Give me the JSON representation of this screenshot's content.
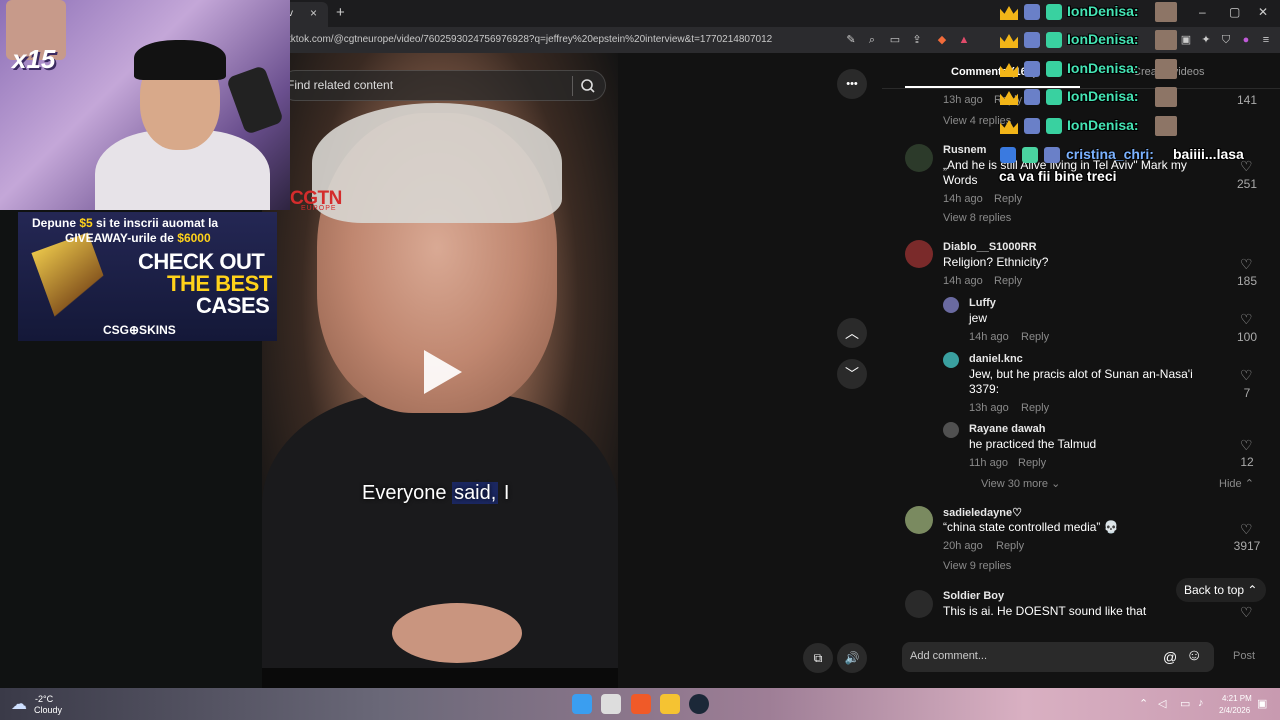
{
  "browser": {
    "tab_label": "v",
    "tab_close": "×",
    "new_tab": "+",
    "url": "tktok.com/@cgtneurope/video/7602593024756976928?q=jeffrey%20epstein%20interview&t=1770214807012",
    "window_controls": [
      "–",
      "▢",
      "✕"
    ]
  },
  "video": {
    "search_placeholder": "Find related content",
    "channel_logo": "CGTN",
    "channel_logo_sub": "EUROPE",
    "caption_plain": "Everyone ",
    "caption_highlight": "said,",
    "caption_tail": " I",
    "more_icon": "•••",
    "up_icon": "︿",
    "down_icon": "﹀",
    "volume_icon": "🔊",
    "pip_icon": "⧉"
  },
  "comments_panel": {
    "tab_comments": "Comments (163)",
    "tab_creator": "Creator videos",
    "first_partial": {
      "meta": "13h ago",
      "reply": "Reply",
      "likes": "141",
      "view_replies": "View 4 replies"
    },
    "comments": [
      {
        "user": "Rusnem",
        "text": "„And he is still Alive living in Tel Aviv\" Mark my Words",
        "meta": "14h ago",
        "reply": "Reply",
        "likes": "251",
        "view_replies": "View 8 replies"
      },
      {
        "user": "Diablo__S1000RR",
        "text": "Religion? Ethnicity?",
        "meta": "14h ago",
        "reply": "Reply",
        "likes": "185"
      },
      {
        "user": "sadieledayne♡",
        "text": "“china state controlled media” 💀",
        "meta": "20h ago",
        "reply": "Reply",
        "likes": "3917",
        "view_replies": "View 9 replies"
      },
      {
        "user": "Soldier Boy",
        "text": "This is ai. He DOESNT sound like that"
      }
    ],
    "replies": [
      {
        "user": "Luffy",
        "text": "jew",
        "meta": "14h ago",
        "reply": "Reply",
        "likes": "100"
      },
      {
        "user": "daniel.knc",
        "text": "Jew, but he pracis alot of Sunan an-Nasa'i 3379:",
        "meta": "13h ago",
        "reply": "Reply",
        "likes": "7"
      },
      {
        "user": "Rayane dawah",
        "text": "he practiced the Talmud",
        "meta": "11h ago",
        "reply": "Reply",
        "likes": "12"
      }
    ],
    "view_more": "View 30 more",
    "hide": "Hide",
    "back_to_top": "Back to top",
    "add_comment_placeholder": "Add comment...",
    "post_label": "Post",
    "mention_icon": "@",
    "emoji_icon": "☺"
  },
  "stream_overlay": {
    "multiplier": "x15",
    "ad_line1_pre": "Depune ",
    "ad_line1_money": "$5",
    "ad_line1_post": " si te inscrii auomat la",
    "ad_line2_pre": "GIVEAWAY-urile de ",
    "ad_line2_money": "$6000",
    "ad_headline1": "CHECK OUT",
    "ad_headline2": "THE BEST",
    "ad_headline3": "CASES",
    "ad_brand": "CSG⊕SKINS",
    "chat": [
      {
        "user": "IonDenisa:"
      },
      {
        "user": "IonDenisa:"
      },
      {
        "user": "IonDenisa:"
      },
      {
        "user": "IonDenisa:"
      },
      {
        "user": "IonDenisa:"
      }
    ],
    "chat2_user": "cristina_chri:",
    "chat2_msg1": "baiiii...lasa",
    "chat2_msg2": "ca va fii bine treci"
  },
  "taskbar": {
    "temp": "-2°C",
    "condition": "Cloudy",
    "time": "4:21 PM",
    "date": "2/4/2026"
  },
  "colors": {
    "accent_chat": "#45e3b4",
    "ad_yellow": "#ffd21a",
    "cgtn_red": "#d42c2c"
  }
}
